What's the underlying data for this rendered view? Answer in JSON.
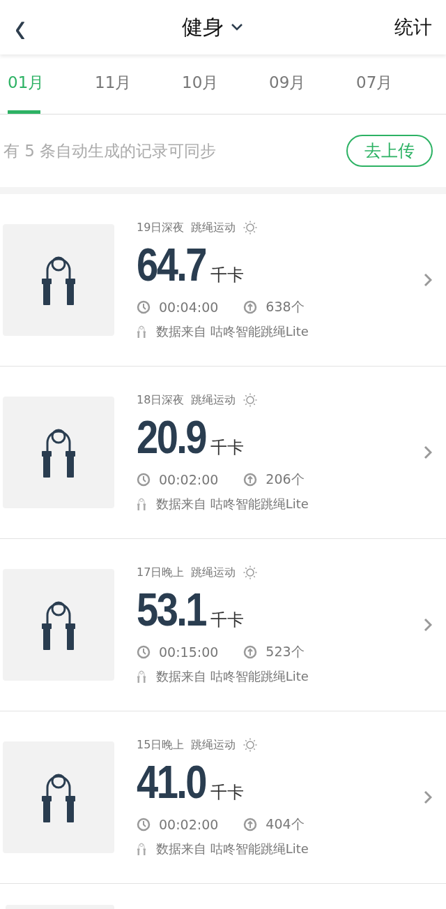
{
  "header": {
    "back": "‹",
    "title": "健身",
    "action": "统计"
  },
  "tabs": [
    {
      "label": "01月",
      "selected": true
    },
    {
      "label": "11月",
      "selected": false
    },
    {
      "label": "10月",
      "selected": false
    },
    {
      "label": "09月",
      "selected": false
    },
    {
      "label": "07月",
      "selected": false
    }
  ],
  "sync_banner": {
    "text": "有 5 条自动生成的记录可同步",
    "button": "去上传"
  },
  "records": [
    {
      "time": "19日深夜",
      "type": "跳绳运动",
      "calories": "64.7",
      "unit": "千卡",
      "duration": "00:04:00",
      "count": "638个",
      "source": "数据来自 咕咚智能跳绳Lite"
    },
    {
      "time": "18日深夜",
      "type": "跳绳运动",
      "calories": "20.9",
      "unit": "千卡",
      "duration": "00:02:00",
      "count": "206个",
      "source": "数据来自 咕咚智能跳绳Lite"
    },
    {
      "time": "17日晚上",
      "type": "跳绳运动",
      "calories": "53.1",
      "unit": "千卡",
      "duration": "00:15:00",
      "count": "523个",
      "source": "数据来自 咕咚智能跳绳Lite"
    },
    {
      "time": "15日晚上",
      "type": "跳绳运动",
      "calories": "41.0",
      "unit": "千卡",
      "duration": "00:02:00",
      "count": "404个",
      "source": "数据来自 咕咚智能跳绳Lite"
    }
  ]
}
